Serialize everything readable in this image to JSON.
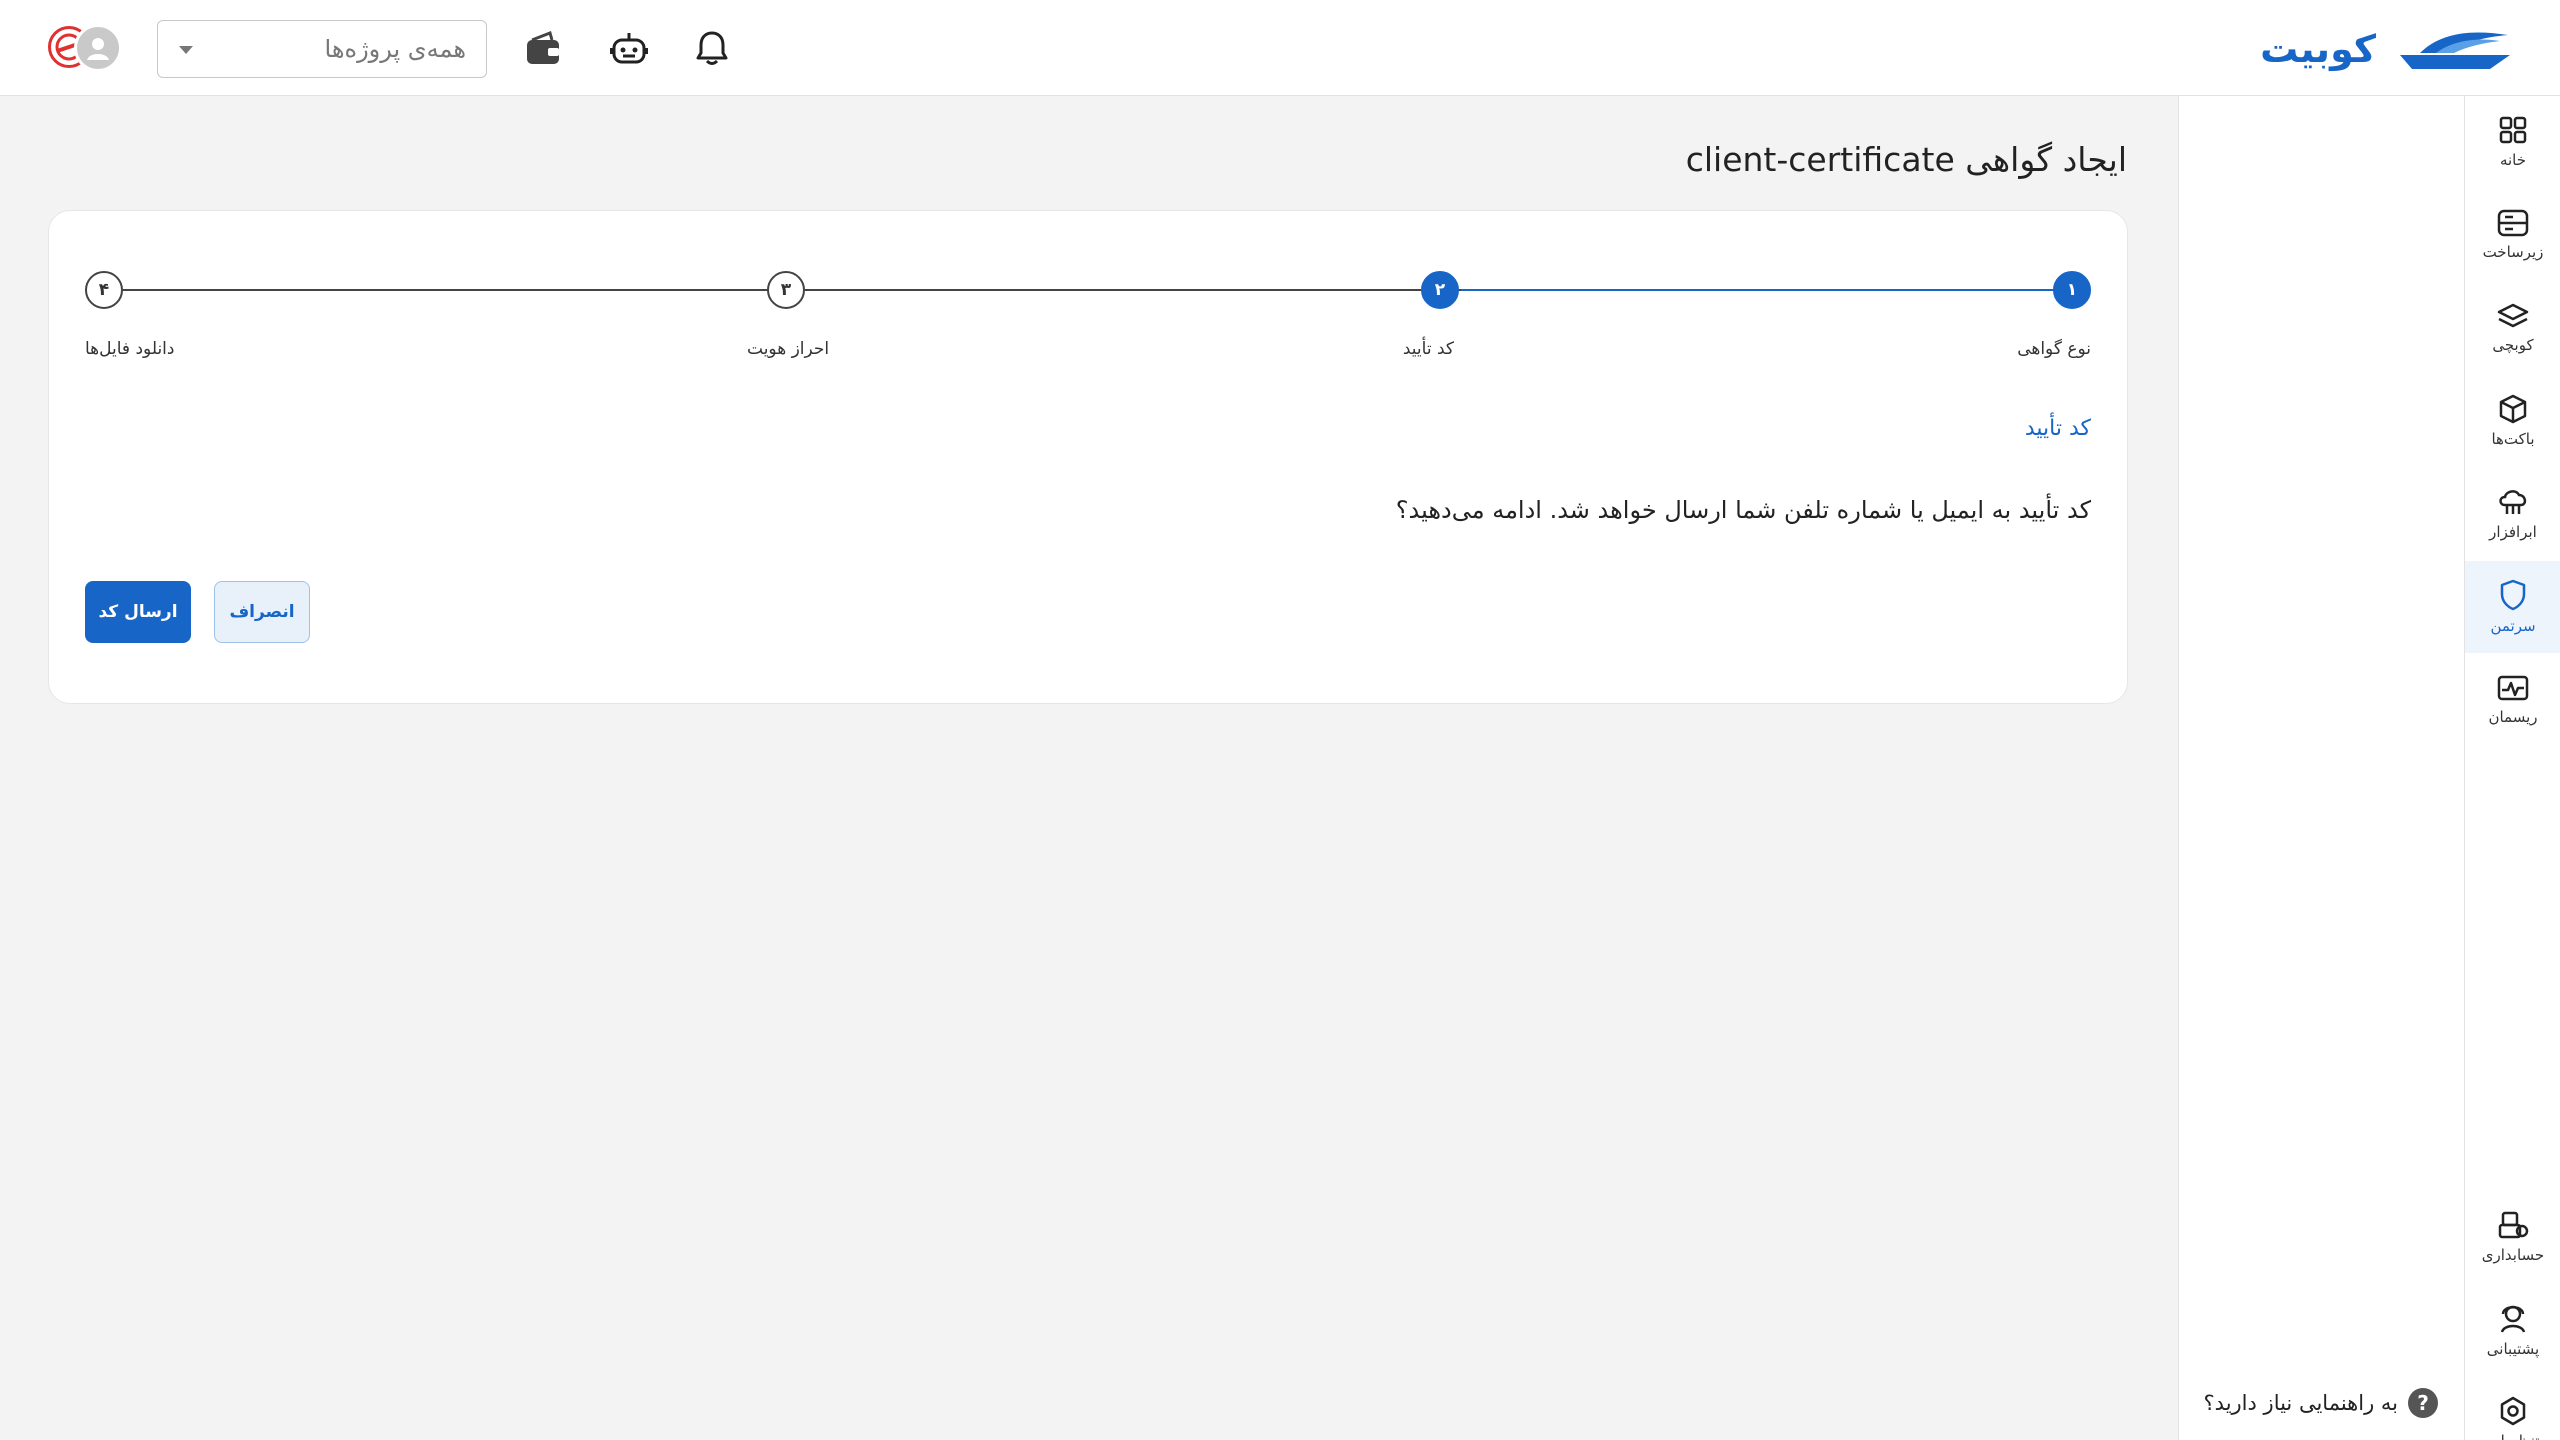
{
  "brand": {
    "name": "کوبیت",
    "accent": "#1766c7"
  },
  "header": {
    "project_select_placeholder": "همه‌ی پروژه‌ها",
    "icons": [
      "bell-icon",
      "robot-icon",
      "wallet-icon",
      "chevron-down-icon",
      "user-avatar-icon"
    ]
  },
  "page": {
    "title": "ایجاد گواهی client-certificate"
  },
  "stepper": {
    "steps": [
      {
        "num": "۱",
        "label": "نوع گواهی",
        "state": "done"
      },
      {
        "num": "۲",
        "label": "کد تأیید",
        "state": "current"
      },
      {
        "num": "۳",
        "label": "احراز هویت",
        "state": "todo"
      },
      {
        "num": "۴",
        "label": "دانلود فایل‌ها",
        "state": "todo"
      }
    ]
  },
  "section": {
    "title": "کد تأیید",
    "message": "کد تأیید به ایمیل یا شماره تلفن شما ارسال خواهد شد. ادامه می‌دهید؟"
  },
  "buttons": {
    "send_code": "ارسال کد",
    "cancel": "انصراف"
  },
  "sidebar": {
    "items": [
      {
        "label": "خانه",
        "icon": "grid-icon"
      },
      {
        "label": "زیرساخت",
        "icon": "server-icon"
      },
      {
        "label": "کوبچی",
        "icon": "layers-icon"
      },
      {
        "label": "باکت‌ها",
        "icon": "box-icon"
      },
      {
        "label": "ابرافزار",
        "icon": "cloud-app-icon"
      },
      {
        "label": "سرتمن",
        "icon": "shield-icon",
        "active": true
      },
      {
        "label": "ریسمان",
        "icon": "pulse-icon"
      }
    ],
    "bottom_items": [
      {
        "label": "حسابداری",
        "icon": "accounting-icon"
      },
      {
        "label": "پشتیبانی",
        "icon": "support-icon"
      },
      {
        "label": "تنظیمات",
        "icon": "settings-icon"
      }
    ]
  },
  "help": {
    "text": "به راهنمایی نیاز دارید؟",
    "icon": "question-icon"
  }
}
